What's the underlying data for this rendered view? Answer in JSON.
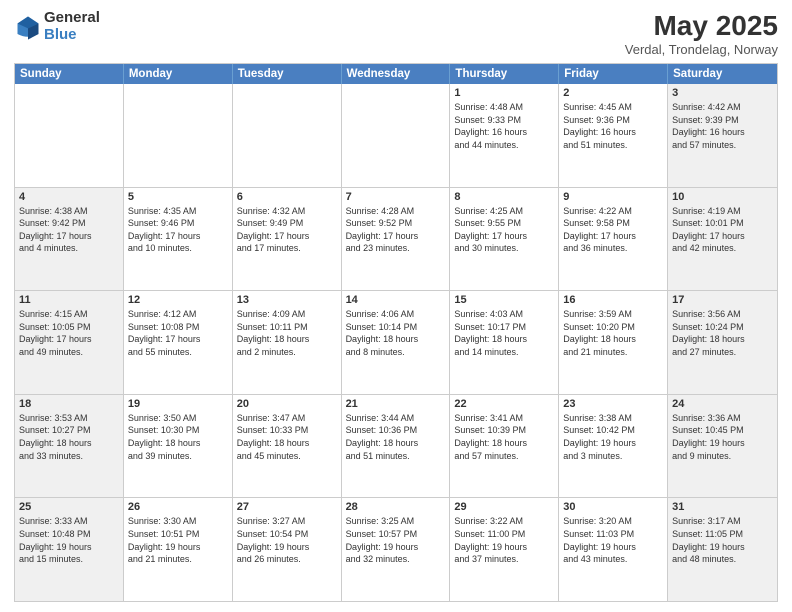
{
  "logo": {
    "general": "General",
    "blue": "Blue"
  },
  "title": "May 2025",
  "location": "Verdal, Trondelag, Norway",
  "days_of_week": [
    "Sunday",
    "Monday",
    "Tuesday",
    "Wednesday",
    "Thursday",
    "Friday",
    "Saturday"
  ],
  "weeks": [
    [
      {
        "day": "",
        "info": "",
        "weekend": false,
        "empty": true
      },
      {
        "day": "",
        "info": "",
        "weekend": false,
        "empty": true
      },
      {
        "day": "",
        "info": "",
        "weekend": false,
        "empty": true
      },
      {
        "day": "",
        "info": "",
        "weekend": false,
        "empty": true
      },
      {
        "day": "1",
        "info": "Sunrise: 4:48 AM\nSunset: 9:33 PM\nDaylight: 16 hours\nand 44 minutes.",
        "weekend": false,
        "empty": false
      },
      {
        "day": "2",
        "info": "Sunrise: 4:45 AM\nSunset: 9:36 PM\nDaylight: 16 hours\nand 51 minutes.",
        "weekend": false,
        "empty": false
      },
      {
        "day": "3",
        "info": "Sunrise: 4:42 AM\nSunset: 9:39 PM\nDaylight: 16 hours\nand 57 minutes.",
        "weekend": true,
        "empty": false
      }
    ],
    [
      {
        "day": "4",
        "info": "Sunrise: 4:38 AM\nSunset: 9:42 PM\nDaylight: 17 hours\nand 4 minutes.",
        "weekend": true,
        "empty": false
      },
      {
        "day": "5",
        "info": "Sunrise: 4:35 AM\nSunset: 9:46 PM\nDaylight: 17 hours\nand 10 minutes.",
        "weekend": false,
        "empty": false
      },
      {
        "day": "6",
        "info": "Sunrise: 4:32 AM\nSunset: 9:49 PM\nDaylight: 17 hours\nand 17 minutes.",
        "weekend": false,
        "empty": false
      },
      {
        "day": "7",
        "info": "Sunrise: 4:28 AM\nSunset: 9:52 PM\nDaylight: 17 hours\nand 23 minutes.",
        "weekend": false,
        "empty": false
      },
      {
        "day": "8",
        "info": "Sunrise: 4:25 AM\nSunset: 9:55 PM\nDaylight: 17 hours\nand 30 minutes.",
        "weekend": false,
        "empty": false
      },
      {
        "day": "9",
        "info": "Sunrise: 4:22 AM\nSunset: 9:58 PM\nDaylight: 17 hours\nand 36 minutes.",
        "weekend": false,
        "empty": false
      },
      {
        "day": "10",
        "info": "Sunrise: 4:19 AM\nSunset: 10:01 PM\nDaylight: 17 hours\nand 42 minutes.",
        "weekend": true,
        "empty": false
      }
    ],
    [
      {
        "day": "11",
        "info": "Sunrise: 4:15 AM\nSunset: 10:05 PM\nDaylight: 17 hours\nand 49 minutes.",
        "weekend": true,
        "empty": false
      },
      {
        "day": "12",
        "info": "Sunrise: 4:12 AM\nSunset: 10:08 PM\nDaylight: 17 hours\nand 55 minutes.",
        "weekend": false,
        "empty": false
      },
      {
        "day": "13",
        "info": "Sunrise: 4:09 AM\nSunset: 10:11 PM\nDaylight: 18 hours\nand 2 minutes.",
        "weekend": false,
        "empty": false
      },
      {
        "day": "14",
        "info": "Sunrise: 4:06 AM\nSunset: 10:14 PM\nDaylight: 18 hours\nand 8 minutes.",
        "weekend": false,
        "empty": false
      },
      {
        "day": "15",
        "info": "Sunrise: 4:03 AM\nSunset: 10:17 PM\nDaylight: 18 hours\nand 14 minutes.",
        "weekend": false,
        "empty": false
      },
      {
        "day": "16",
        "info": "Sunrise: 3:59 AM\nSunset: 10:20 PM\nDaylight: 18 hours\nand 21 minutes.",
        "weekend": false,
        "empty": false
      },
      {
        "day": "17",
        "info": "Sunrise: 3:56 AM\nSunset: 10:24 PM\nDaylight: 18 hours\nand 27 minutes.",
        "weekend": true,
        "empty": false
      }
    ],
    [
      {
        "day": "18",
        "info": "Sunrise: 3:53 AM\nSunset: 10:27 PM\nDaylight: 18 hours\nand 33 minutes.",
        "weekend": true,
        "empty": false
      },
      {
        "day": "19",
        "info": "Sunrise: 3:50 AM\nSunset: 10:30 PM\nDaylight: 18 hours\nand 39 minutes.",
        "weekend": false,
        "empty": false
      },
      {
        "day": "20",
        "info": "Sunrise: 3:47 AM\nSunset: 10:33 PM\nDaylight: 18 hours\nand 45 minutes.",
        "weekend": false,
        "empty": false
      },
      {
        "day": "21",
        "info": "Sunrise: 3:44 AM\nSunset: 10:36 PM\nDaylight: 18 hours\nand 51 minutes.",
        "weekend": false,
        "empty": false
      },
      {
        "day": "22",
        "info": "Sunrise: 3:41 AM\nSunset: 10:39 PM\nDaylight: 18 hours\nand 57 minutes.",
        "weekend": false,
        "empty": false
      },
      {
        "day": "23",
        "info": "Sunrise: 3:38 AM\nSunset: 10:42 PM\nDaylight: 19 hours\nand 3 minutes.",
        "weekend": false,
        "empty": false
      },
      {
        "day": "24",
        "info": "Sunrise: 3:36 AM\nSunset: 10:45 PM\nDaylight: 19 hours\nand 9 minutes.",
        "weekend": true,
        "empty": false
      }
    ],
    [
      {
        "day": "25",
        "info": "Sunrise: 3:33 AM\nSunset: 10:48 PM\nDaylight: 19 hours\nand 15 minutes.",
        "weekend": true,
        "empty": false
      },
      {
        "day": "26",
        "info": "Sunrise: 3:30 AM\nSunset: 10:51 PM\nDaylight: 19 hours\nand 21 minutes.",
        "weekend": false,
        "empty": false
      },
      {
        "day": "27",
        "info": "Sunrise: 3:27 AM\nSunset: 10:54 PM\nDaylight: 19 hours\nand 26 minutes.",
        "weekend": false,
        "empty": false
      },
      {
        "day": "28",
        "info": "Sunrise: 3:25 AM\nSunset: 10:57 PM\nDaylight: 19 hours\nand 32 minutes.",
        "weekend": false,
        "empty": false
      },
      {
        "day": "29",
        "info": "Sunrise: 3:22 AM\nSunset: 11:00 PM\nDaylight: 19 hours\nand 37 minutes.",
        "weekend": false,
        "empty": false
      },
      {
        "day": "30",
        "info": "Sunrise: 3:20 AM\nSunset: 11:03 PM\nDaylight: 19 hours\nand 43 minutes.",
        "weekend": false,
        "empty": false
      },
      {
        "day": "31",
        "info": "Sunrise: 3:17 AM\nSunset: 11:05 PM\nDaylight: 19 hours\nand 48 minutes.",
        "weekend": true,
        "empty": false
      }
    ]
  ]
}
